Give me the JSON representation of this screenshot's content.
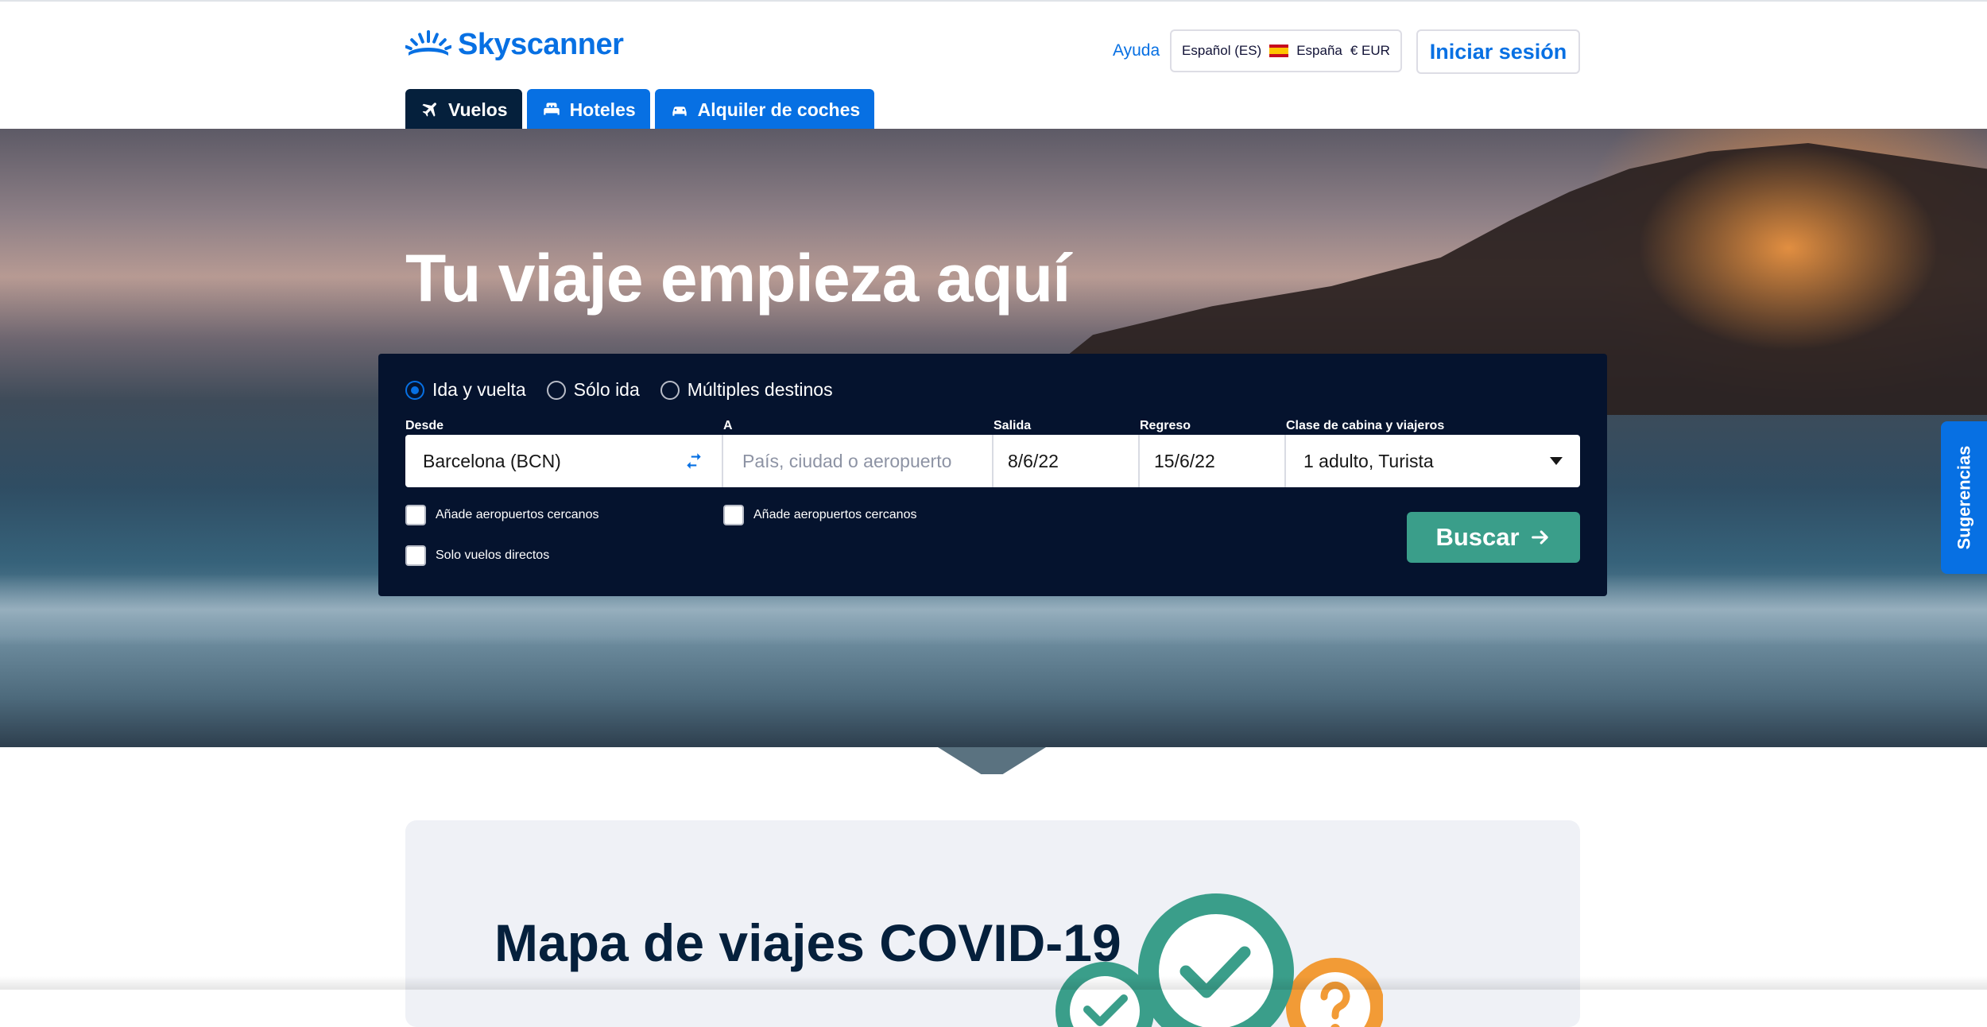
{
  "brand": {
    "name": "Skyscanner",
    "color": "#0770e3"
  },
  "header": {
    "help_label": "Ayuda",
    "locale": {
      "language": "Español (ES)",
      "country": "España",
      "currency": "€ EUR"
    },
    "login_label": "Iniciar sesión"
  },
  "tabs": [
    {
      "label": "Vuelos",
      "icon": "plane-icon",
      "active": true
    },
    {
      "label": "Hoteles",
      "icon": "bed-icon",
      "active": false
    },
    {
      "label": "Alquiler de coches",
      "icon": "car-icon",
      "active": false
    }
  ],
  "hero": {
    "title": "Tu viaje empieza aquí"
  },
  "search": {
    "trip_types": [
      {
        "label": "Ida y vuelta",
        "selected": true
      },
      {
        "label": "Sólo ida",
        "selected": false
      },
      {
        "label": "Múltiples destinos",
        "selected": false
      }
    ],
    "labels": {
      "from": "Desde",
      "to": "A",
      "depart": "Salida",
      "return": "Regreso",
      "cabin": "Clase de cabina y viajeros"
    },
    "from_value": "Barcelona (BCN)",
    "to_placeholder": "País, ciudad o aeropuerto",
    "depart_value": "8/6/22",
    "return_value": "15/6/22",
    "cabin_value": "1 adulto, Turista",
    "nearby_from_label": "Añade aeropuertos cercanos",
    "nearby_to_label": "Añade aeropuertos cercanos",
    "direct_label": "Solo vuelos directos",
    "search_label": "Buscar",
    "search_color": "#3a9e8a"
  },
  "side_tab": {
    "label": "Sugerencias"
  },
  "covid": {
    "title": "Mapa de viajes COVID-19"
  }
}
